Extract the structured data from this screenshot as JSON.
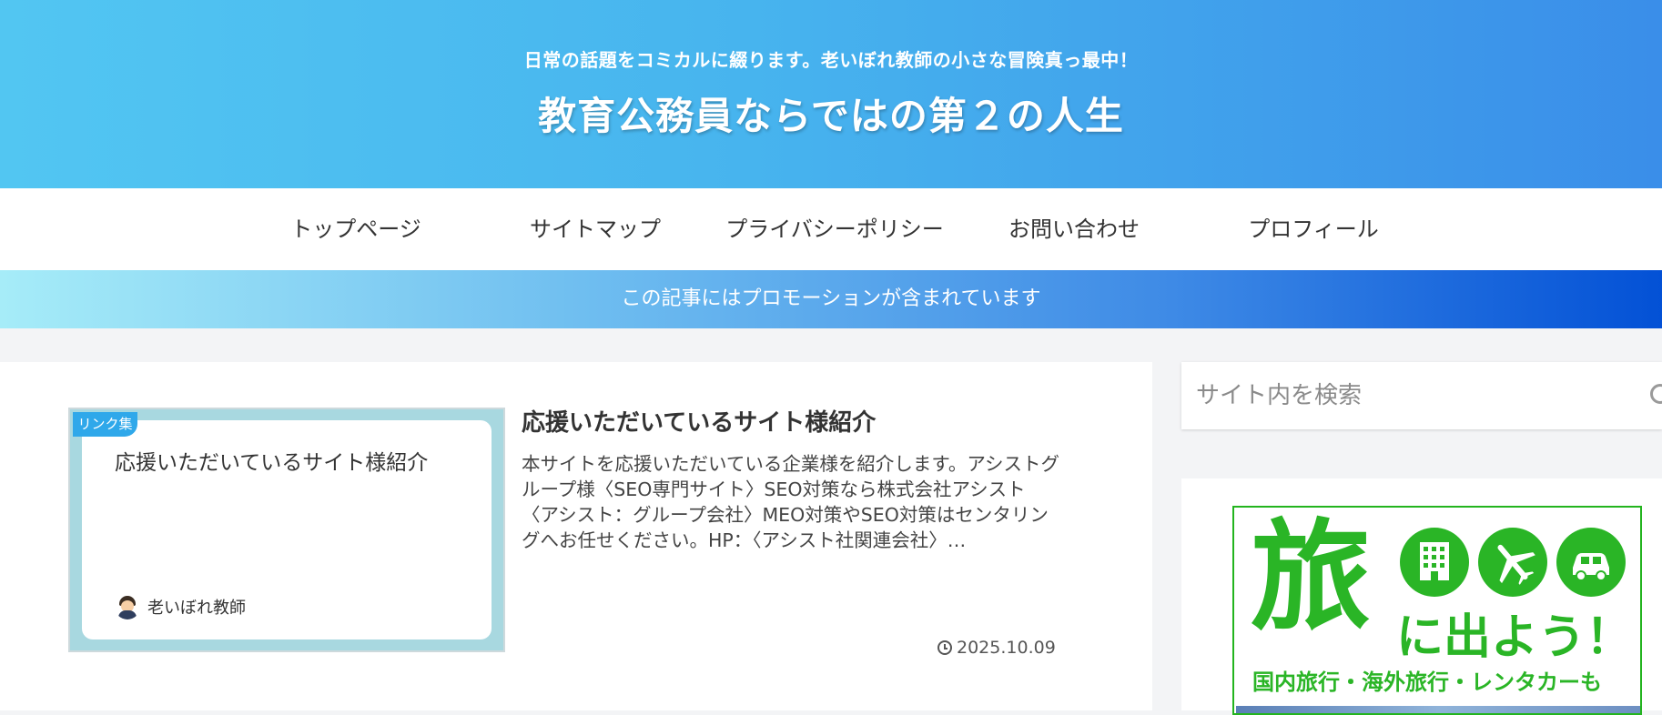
{
  "header": {
    "tagline": "日常の話題をコミカルに綴ります。老いぼれ教師の小さな冒険真っ最中！",
    "title": "教育公務員ならではの第２の人生"
  },
  "nav": {
    "items": [
      {
        "label": "トップページ"
      },
      {
        "label": "サイトマップ"
      },
      {
        "label": "プライバシーポリシー"
      },
      {
        "label": "お問い合わせ"
      },
      {
        "label": "プロフィール"
      }
    ]
  },
  "promo": {
    "text": "この記事にはプロモーションが含まれています"
  },
  "entry": {
    "category": "リンク集",
    "thumb_title": "応援いただいているサイト様紹介",
    "author": "老いぼれ教師",
    "title": "応援いただいているサイト様紹介",
    "snippet": "本サイトを応援いただいている企業様を紹介します。アシストグループ様〈SEO専門サイト〉SEO対策なら株式会社アシスト〈アシスト：グループ会社〉MEO対策やSEO対策はセンタリングへお任せください。HP：〈アシスト社関連会社〉…",
    "date": "2025.10.09"
  },
  "sidebar": {
    "search_placeholder": "サイト内を検索",
    "ad": {
      "big_char": "旅",
      "sub_text": "に出よう！",
      "bottom_text": "国内旅行・海外旅行・レンタカーも",
      "icons": [
        "building-icon",
        "airplane-icon",
        "car-icon"
      ],
      "brand_color": "#2ab526"
    }
  },
  "colors": {
    "header_gradient_start": "#52c6f2",
    "header_gradient_end": "#3a8ee9",
    "promo_gradient_start": "#a6ecf8",
    "promo_gradient_end": "#0351d6",
    "category_badge": "#2fa8ea"
  }
}
